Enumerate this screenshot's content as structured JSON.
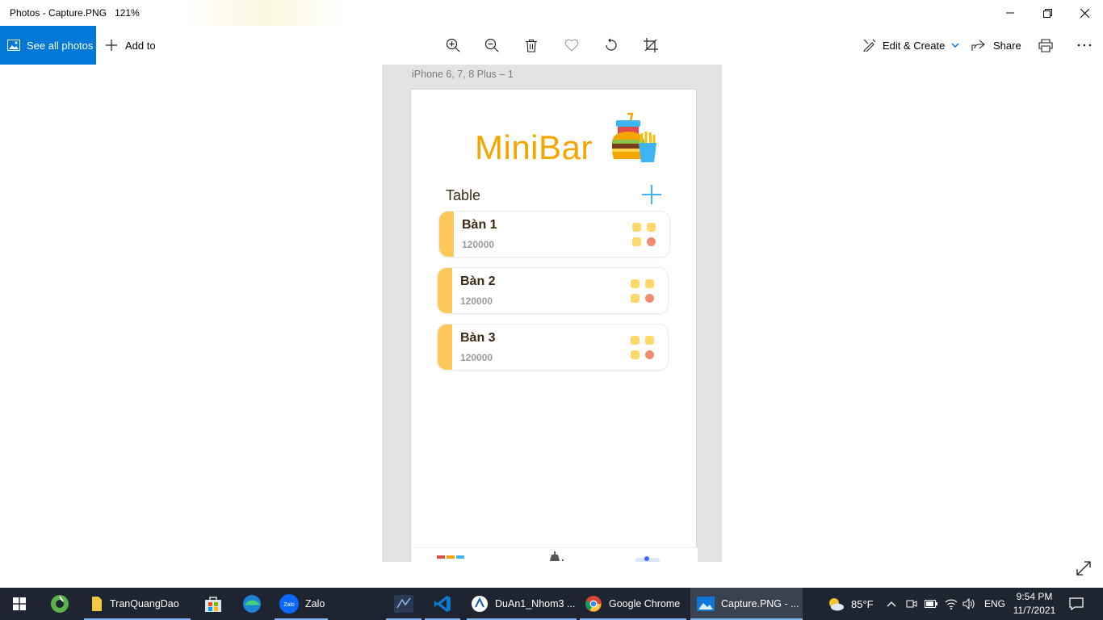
{
  "window": {
    "title": "Photos - Capture.PNG",
    "zoom": "121%"
  },
  "toolbar": {
    "see_all_label": "See all photos",
    "add_to_label": "Add to",
    "edit_create_label": "Edit & Create",
    "share_label": "Share"
  },
  "image": {
    "frame_label": "iPhone 6, 7, 8 Plus – 1",
    "app": {
      "logo_text": "MiniBar",
      "section_title": "Table",
      "tables": [
        {
          "name": "Bàn 1",
          "price": "120000"
        },
        {
          "name": "Bàn 2",
          "price": "120000"
        },
        {
          "name": "Bàn 3",
          "price": "120000"
        }
      ],
      "colors": {
        "brand": "#f5a500",
        "add": "#3fb4f5",
        "strip": "#ffc85a",
        "dot": "#ffd86b",
        "dot_alt": "#f08c70"
      }
    }
  },
  "taskbar": {
    "items": [
      {
        "label": "TranQuangDao"
      },
      {
        "label": "Zalo"
      },
      {
        "label": "DuAn1_Nhom3 ..."
      },
      {
        "label": "Google Chrome"
      },
      {
        "label": "Capture.PNG - ..."
      }
    ],
    "weather": "85°F",
    "lang": "ENG",
    "time": "9:54 PM",
    "date": "11/7/2021"
  }
}
